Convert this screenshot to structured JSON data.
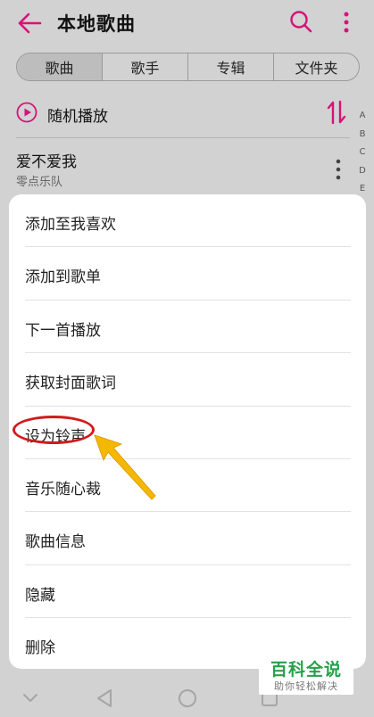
{
  "header": {
    "title": "本地歌曲"
  },
  "tabs": [
    "歌曲",
    "歌手",
    "专辑",
    "文件夹"
  ],
  "shuffle": {
    "label": "随机播放"
  },
  "song": {
    "title": "爱不爱我",
    "artist": "零点乐队"
  },
  "alphabet": [
    "A",
    "B",
    "C",
    "D",
    "E"
  ],
  "menu": [
    {
      "label": "添加至我喜欢"
    },
    {
      "label": "添加到歌单"
    },
    {
      "label": "下一首播放"
    },
    {
      "label": "获取封面歌词"
    },
    {
      "label": "设为铃声"
    },
    {
      "label": "音乐随心裁"
    },
    {
      "label": "歌曲信息"
    },
    {
      "label": "隐藏"
    },
    {
      "label": "删除"
    }
  ],
  "watermark": {
    "title": "百科全说",
    "subtitle": "助你轻松解决"
  },
  "colors": {
    "accent": "#d6137a",
    "annotation_red": "#d11b1b",
    "annotation_arrow": "#f5b800",
    "watermark_green": "#27a04a"
  }
}
